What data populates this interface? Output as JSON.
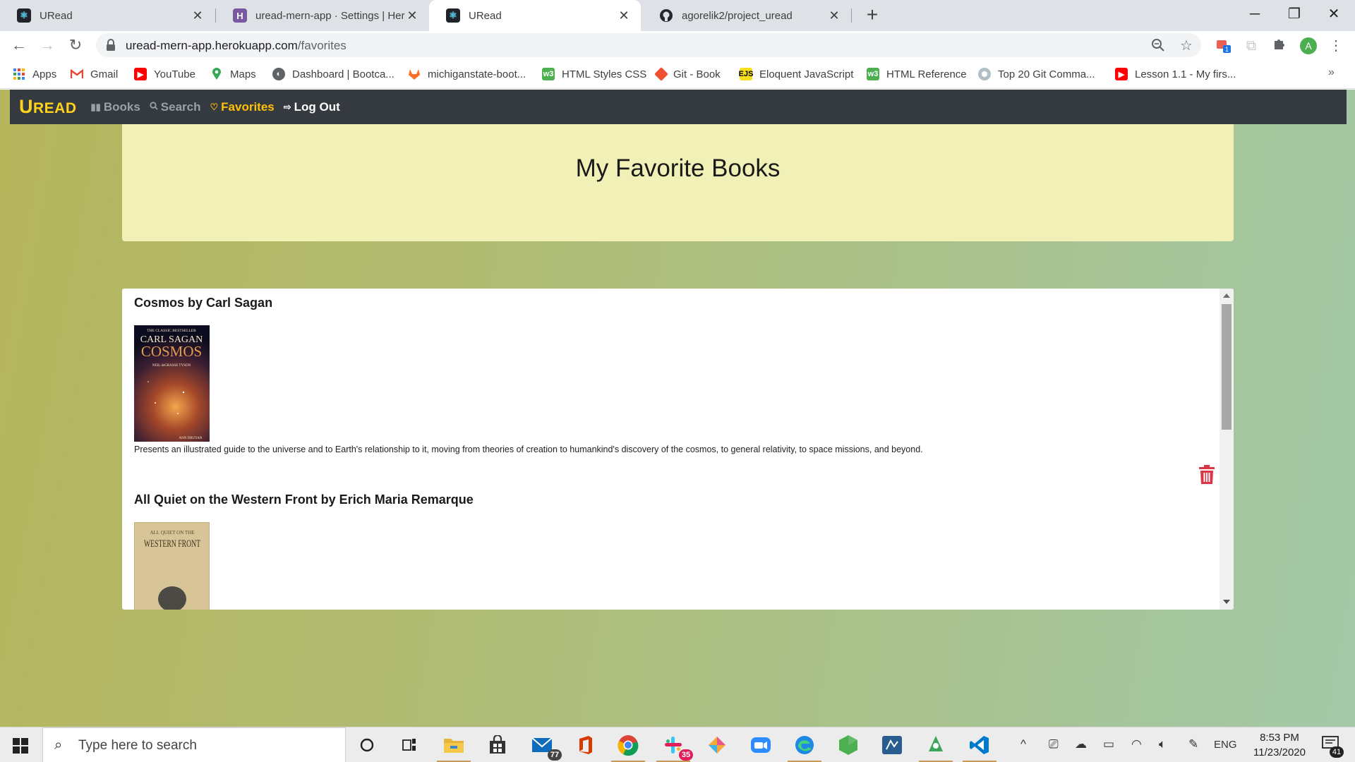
{
  "browser": {
    "tabs": [
      {
        "title": "URead",
        "icon": "react-icon",
        "active": false
      },
      {
        "title": "uread-mern-app · Settings | Hero",
        "icon": "heroku-icon",
        "active": false
      },
      {
        "title": "URead",
        "icon": "react-icon",
        "active": true
      },
      {
        "title": "agorelik2/project_uread",
        "icon": "github-icon",
        "active": false
      }
    ],
    "new_tab_label": "+",
    "address": {
      "host": "uread-mern-app.herokuapp.com",
      "path": "/favorites"
    },
    "profile_initial": "A",
    "extension_badge": "1",
    "bookmarks": [
      {
        "label": "Apps",
        "icon": "apps-grid-icon",
        "color": "#4285f4"
      },
      {
        "label": "Gmail",
        "icon": "gmail-icon",
        "color": "#ea4335"
      },
      {
        "label": "YouTube",
        "icon": "youtube-icon",
        "color": "#ff0000"
      },
      {
        "label": "Maps",
        "icon": "maps-pin-icon",
        "color": "#34a853"
      },
      {
        "label": "Dashboard | Bootca...",
        "icon": "globe-icon",
        "color": "#5f6368"
      },
      {
        "label": "michiganstate-boot...",
        "icon": "gitlab-icon",
        "color": "#fc6d26"
      },
      {
        "label": "HTML Styles CSS",
        "icon": "w3schools-icon",
        "color": "#4caf50"
      },
      {
        "label": "Git - Book",
        "icon": "git-icon",
        "color": "#f05032"
      },
      {
        "label": "Eloquent JavaScript",
        "icon": "ejs-icon",
        "color": "#f7df1e"
      },
      {
        "label": "HTML Reference",
        "icon": "w3schools-icon",
        "color": "#4caf50"
      },
      {
        "label": "Top 20 Git Comma...",
        "icon": "globe-icon",
        "color": "#7a8fa6"
      },
      {
        "label": "Lesson 1.1 - My firs...",
        "icon": "youtube-icon",
        "color": "#ff0000"
      }
    ],
    "bookmarks_overflow": "»"
  },
  "app": {
    "brand": {
      "big": "U",
      "rest": "READ"
    },
    "nav": [
      {
        "label": "Books",
        "icon": "books-icon",
        "state": "inactive"
      },
      {
        "label": "Search",
        "icon": "search-icon",
        "state": "inactive"
      },
      {
        "label": "Favorites",
        "icon": "heart-icon",
        "state": "active"
      },
      {
        "label": "Log Out",
        "icon": "logout-icon",
        "state": "light"
      }
    ],
    "heading": "My Favorite Books",
    "favorites": [
      {
        "title": "Cosmos by Carl Sagan",
        "cover": {
          "top": "THE CLASSIC BESTSELLER",
          "author": "CARL SAGAN",
          "name": "COSMOS",
          "sub": "NEIL deGRASSE TYSON",
          "bottom": "ANN DRUYAN"
        },
        "description": "Presents an illustrated guide to the universe and to Earth's relationship to it, moving from theories of creation to humankind's discovery of the cosmos, to general relativity, to space missions, and beyond."
      },
      {
        "title": "All Quiet on the Western Front by Erich Maria Remarque",
        "cover": {
          "top": "ALL QUIET ON THE",
          "author": "",
          "name": "WESTERN FRONT",
          "sub": "",
          "bottom": ""
        },
        "description": ""
      }
    ],
    "accent_color": "#ffc107",
    "delete_color": "#dc3545"
  },
  "taskbar": {
    "search_placeholder": "Type here to search",
    "mail_badge": "77",
    "slack_badge": "35",
    "language": "ENG",
    "time": "8:53 PM",
    "date": "11/23/2020",
    "notifications": "41"
  }
}
